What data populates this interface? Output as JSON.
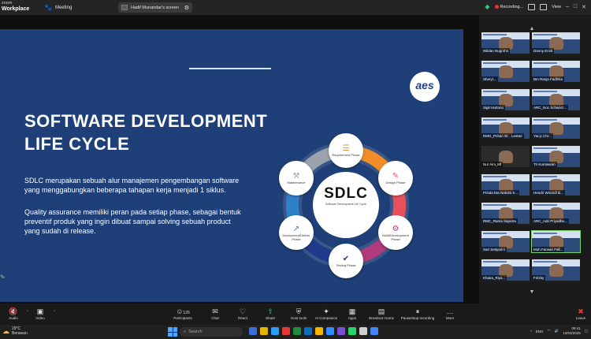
{
  "topbar": {
    "brand_line1": "zoom",
    "brand_line2": "Workplace",
    "meeting_label": "Meeting",
    "share_label": "Hadif Munandar's screen",
    "recording_label": "Recording...",
    "view_label": "View"
  },
  "slide": {
    "title": "SOFTWARE DEVELOPMENT LIFE CYCLE",
    "paragraph1": "SDLC merupakan sebuah alur manajemen pengembangan software yang menggabungkan beberapa tahapan kerja menjadi 1 siklus.",
    "paragraph2": "Quality assurance memiliki peran pada setiap phase, sebagai bentuk preventif produk yang ingin dibuat sampai solving sebuah product yang sudah di release.",
    "center_title": "SDLC",
    "center_subtitle": "Software Development Life Cycle",
    "phases": [
      {
        "label": "Requirement Phase",
        "icon": "clipboard-icon",
        "color": "#f28c28"
      },
      {
        "label": "Design Phase",
        "icon": "design-icon",
        "color": "#e8505b"
      },
      {
        "label": "Build/Development Phase",
        "icon": "gear-icon",
        "color": "#b03a7a"
      },
      {
        "label": "Testing Phase",
        "icon": "test-icon",
        "color": "#1f3a8a"
      },
      {
        "label": "Deployment/Deliver Phase",
        "icon": "rocket-icon",
        "color": "#2f80c8"
      },
      {
        "label": "Maintenance",
        "icon": "wrench-icon",
        "color": "#9aa3ad"
      }
    ]
  },
  "participants": [
    {
      "name": "Wildan Nugroho"
    },
    {
      "name": "Danny Erick"
    },
    {
      "name": "Sheryl..."
    },
    {
      "name": "Bm Ranja Fadhika"
    },
    {
      "name": "Sigit Hartono"
    },
    {
      "name": "ARC_Noc Schwarz..."
    },
    {
      "name": "RMG_Prisan W... Lestari"
    },
    {
      "name": "Yar.jc.Chr..."
    },
    {
      "name": "Nur Aini_Ml"
    },
    {
      "name": "Tri Kurniawan"
    },
    {
      "name": "Prisda Eta Nakula S..."
    },
    {
      "name": "Hendri Winardi B..."
    },
    {
      "name": "RMC_Rama Saputra"
    },
    {
      "name": "ARC_Adri Priyadhe..."
    },
    {
      "name": "Sari Setiyarini"
    },
    {
      "name": "Muh Farwan Fall..."
    },
    {
      "name": "Khaira_Riya..."
    },
    {
      "name": "Fritzky"
    }
  ],
  "toolbar": {
    "audio": "Audio",
    "video": "Video",
    "participants": "Participants",
    "participants_count": "126",
    "chat": "Chat",
    "react": "React",
    "share": "Share",
    "host_tools": "Host tools",
    "ai_companion": "AI Companion",
    "apps": "Apps",
    "breakout_rooms": "Breakout rooms",
    "pause_recording": "Pause/stop recording",
    "more": "More",
    "leave": "Leave"
  },
  "taskbar": {
    "weather_temp": "29°C",
    "weather_desc": "Berawan",
    "search_placeholder": "Search",
    "lang": "ENG",
    "time": "09:41",
    "date": "13/03/2025"
  }
}
